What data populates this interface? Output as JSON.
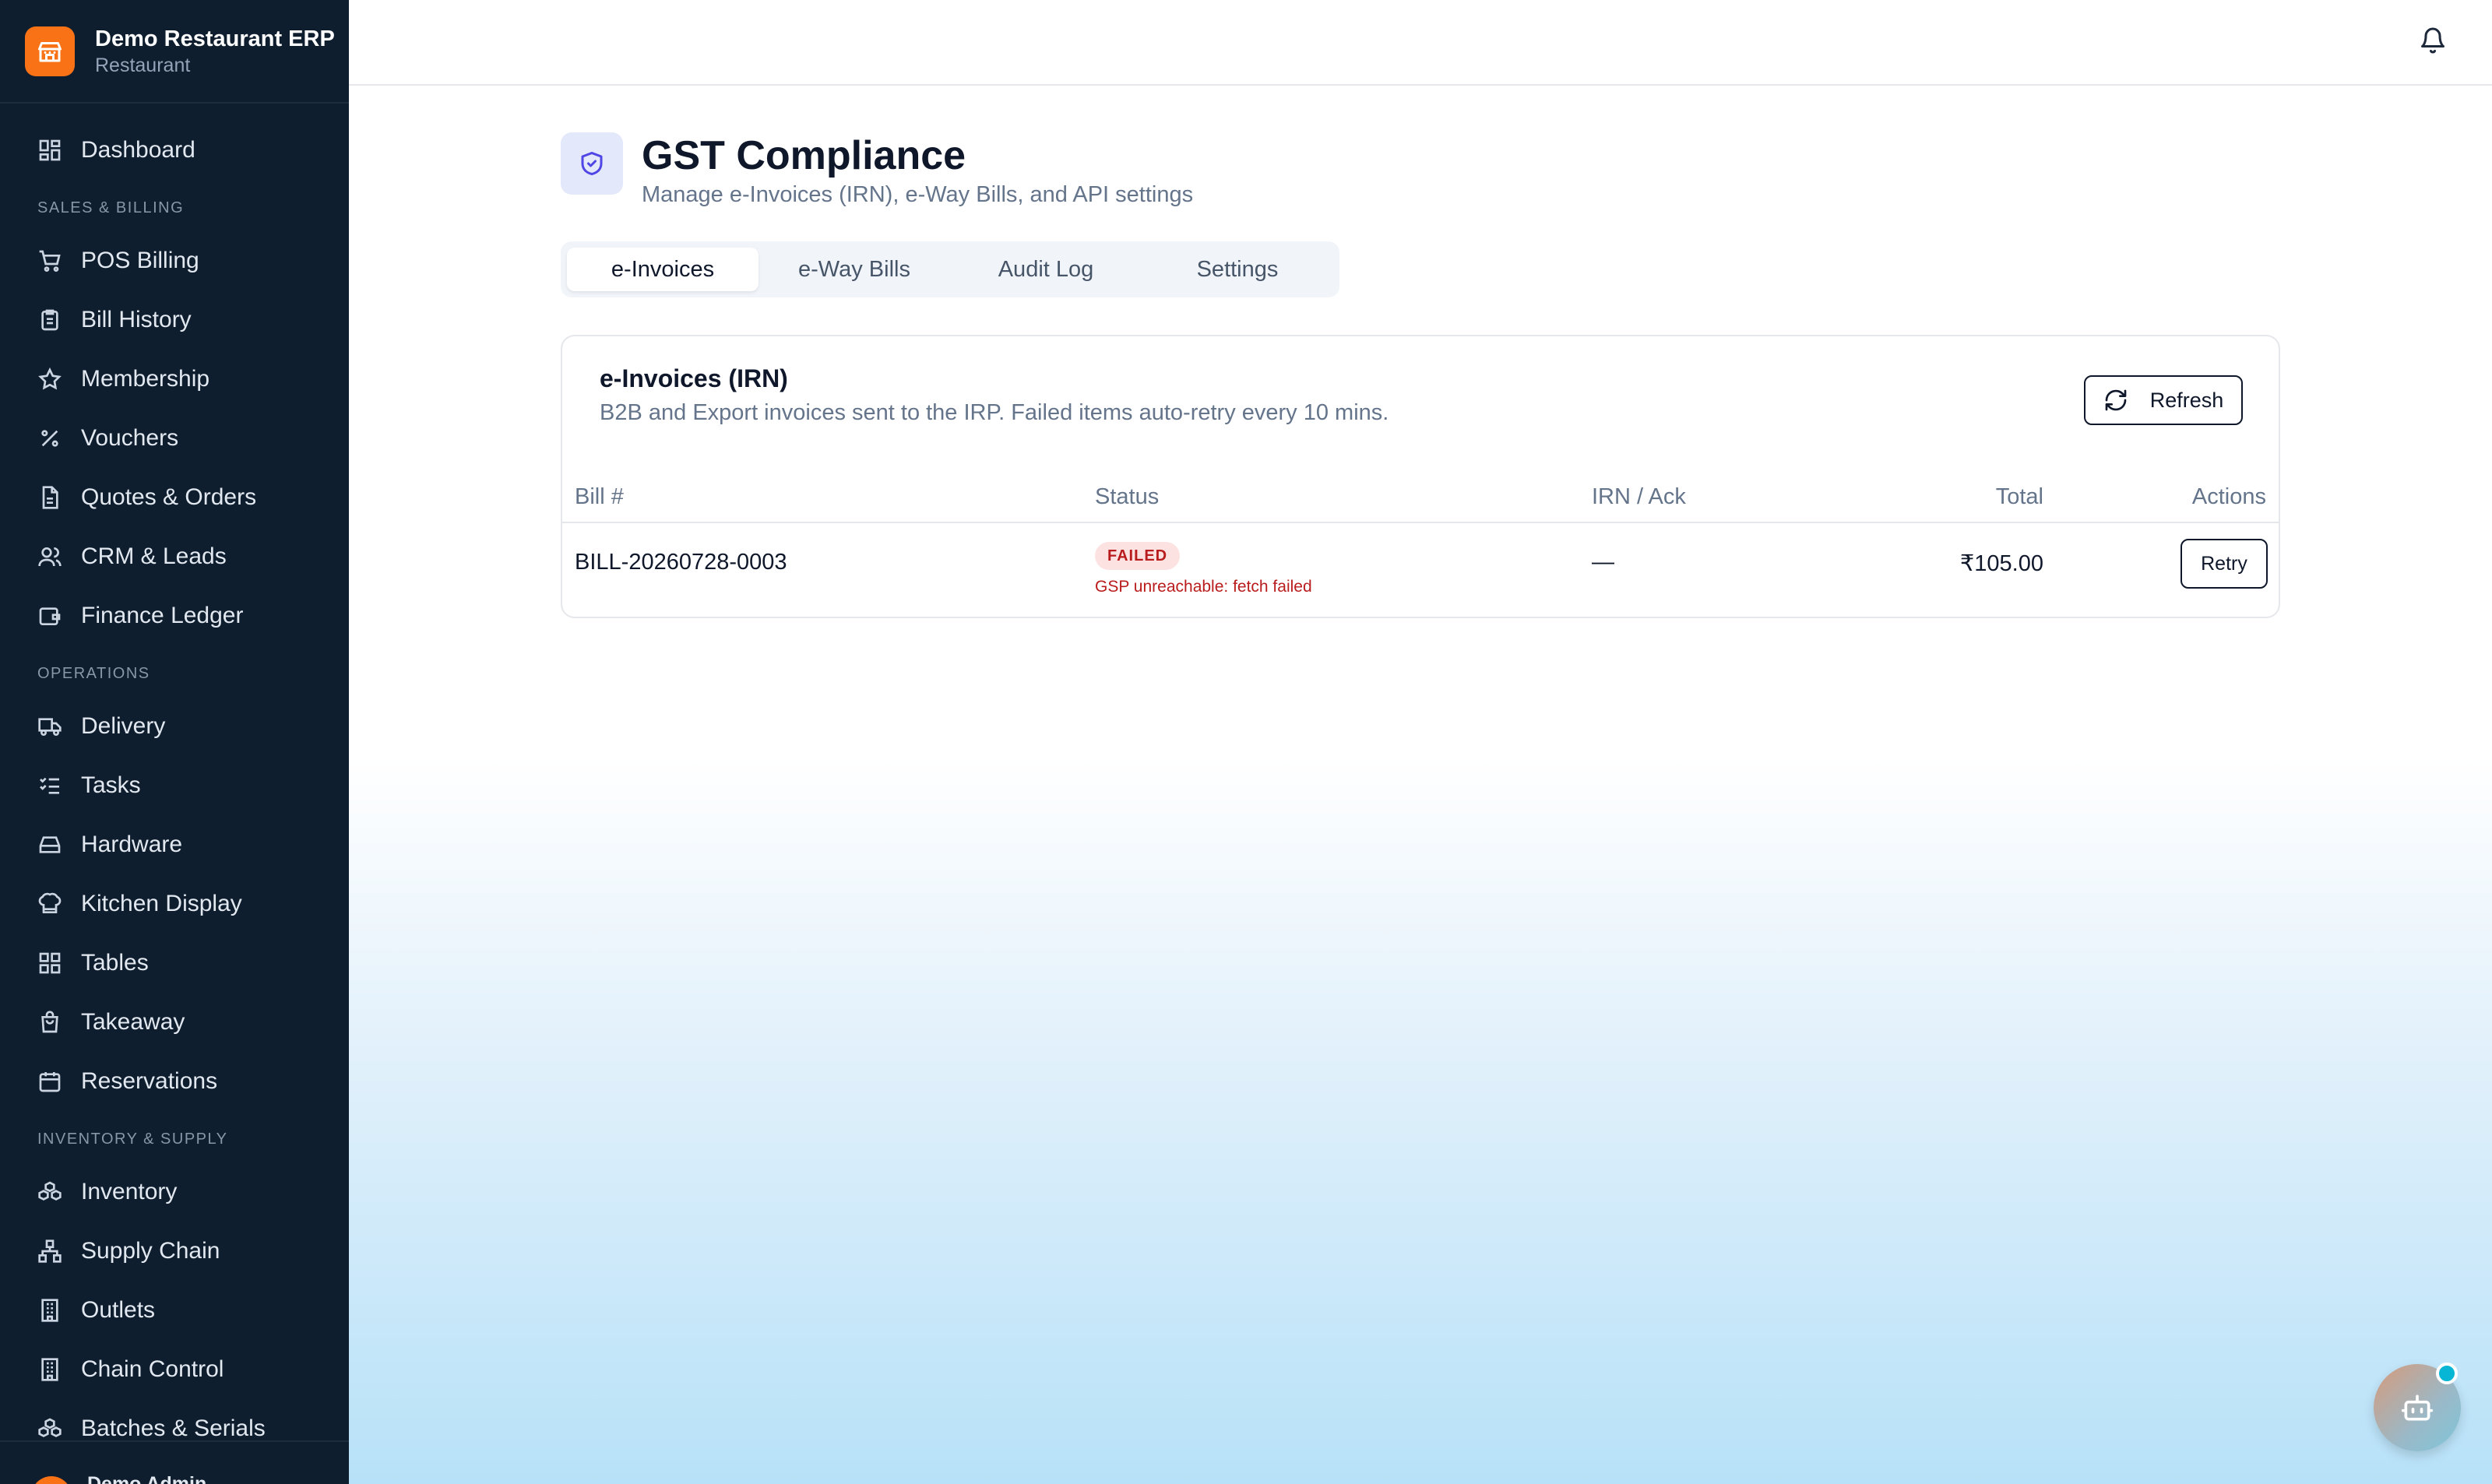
{
  "brand": {
    "name": "Demo Restaurant ERP",
    "subtitle": "Restaurant"
  },
  "sidebar": {
    "dashboard": "Dashboard",
    "sections": {
      "sales_billing": "SALES & BILLING",
      "operations": "OPERATIONS",
      "inventory_supply": "INVENTORY & SUPPLY"
    },
    "sales": [
      "POS Billing",
      "Bill History",
      "Membership",
      "Vouchers",
      "Quotes & Orders",
      "CRM & Leads",
      "Finance Ledger"
    ],
    "operations": [
      "Delivery",
      "Tasks",
      "Hardware",
      "Kitchen Display",
      "Tables",
      "Takeaway",
      "Reservations"
    ],
    "inventory": [
      "Inventory",
      "Supply Chain",
      "Outlets",
      "Chain Control",
      "Batches & Serials"
    ],
    "footer_user": "Demo Admin"
  },
  "page": {
    "title": "GST Compliance",
    "subtitle": "Manage e-Invoices (IRN), e-Way Bills, and API settings"
  },
  "tabs": [
    "e-Invoices",
    "e-Way Bills",
    "Audit Log",
    "Settings"
  ],
  "card": {
    "title": "e-Invoices (IRN)",
    "description": "B2B and Export invoices sent to the IRP. Failed items auto-retry every 10 mins.",
    "refresh_label": "Refresh",
    "columns": [
      "Bill #",
      "Status",
      "IRN / Ack",
      "Total",
      "Actions"
    ],
    "rows": [
      {
        "bill": "BILL-20260728-0003",
        "status": "FAILED",
        "error": "GSP unreachable: fetch failed",
        "irn": "—",
        "total": "₹105.00",
        "action": "Retry"
      }
    ]
  },
  "colors": {
    "sidebar": "#0f1e2e",
    "brand": "#f97316",
    "failed": "#b91c1c",
    "accent": "#06b6d4"
  }
}
